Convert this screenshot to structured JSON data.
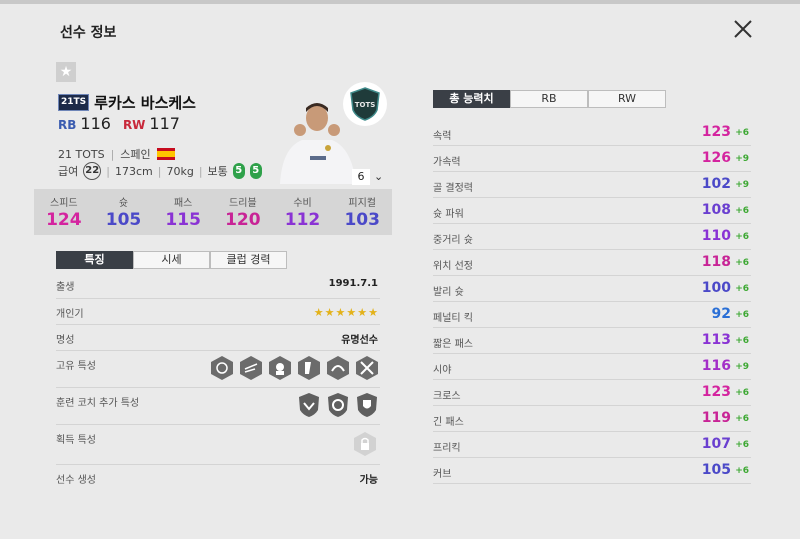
{
  "header": {
    "title": "선수 정보"
  },
  "player": {
    "season": "21TS",
    "name": "루카스 바스케스",
    "positions": [
      {
        "pos": "RB",
        "ovr": "116"
      },
      {
        "pos": "RW",
        "ovr": "117"
      }
    ],
    "season_label": "21 TOTS",
    "nation": "스페인",
    "pay_label": "급여",
    "pay": "22",
    "height": "173cm",
    "weight": "70kg",
    "body": "보통",
    "foot_left": "5",
    "foot_right": "5",
    "badge_text": "TOTS",
    "level": "6"
  },
  "stats": [
    {
      "label": "스피드",
      "value": "124",
      "color": "#d4249f"
    },
    {
      "label": "슛",
      "value": "105",
      "color": "#4b49c8"
    },
    {
      "label": "패스",
      "value": "115",
      "color": "#8a33d4"
    },
    {
      "label": "드리블",
      "value": "120",
      "color": "#c82496"
    },
    {
      "label": "수비",
      "value": "112",
      "color": "#8a33d4"
    },
    {
      "label": "피지컬",
      "value": "103",
      "color": "#4b49c8"
    }
  ],
  "left_tabs": [
    "특징",
    "시세",
    "클럽 경력"
  ],
  "details": {
    "birth_label": "출생",
    "birth": "1991.7.1",
    "popularity_label": "개인기",
    "popularity_stars": 6,
    "fame_label": "명성",
    "fame": "유명선수",
    "traits_label": "고유 특성",
    "trait_icons": [
      "power-header-icon",
      "speed-dribbler-icon",
      "playmaker-icon",
      "power-shot-icon",
      "outside-foot-icon",
      "chip-shot-icon"
    ],
    "coach_label": "훈련 코치 추가 특성",
    "coach_icons": [
      "aerial-icon",
      "stamina-icon",
      "defender-icon"
    ],
    "acquired_label": "획득 특성",
    "generate_label": "선수 생성",
    "generate": "가능"
  },
  "right_tabs": [
    "총 능력치",
    "RB",
    "RW"
  ],
  "abilities": [
    {
      "name": "속력",
      "value": "123",
      "bonus": "+6",
      "color": "#d4249f"
    },
    {
      "name": "가속력",
      "value": "126",
      "bonus": "+9",
      "color": "#d4249f"
    },
    {
      "name": "골 결정력",
      "value": "102",
      "bonus": "+9",
      "color": "#4b49c8"
    },
    {
      "name": "슛 파워",
      "value": "108",
      "bonus": "+6",
      "color": "#6a3fd0"
    },
    {
      "name": "중거리 슛",
      "value": "110",
      "bonus": "+6",
      "color": "#8a33d4"
    },
    {
      "name": "위치 선정",
      "value": "118",
      "bonus": "+6",
      "color": "#c82496"
    },
    {
      "name": "발리 슛",
      "value": "100",
      "bonus": "+6",
      "color": "#4b49c8"
    },
    {
      "name": "페널티 킥",
      "value": "92",
      "bonus": "+6",
      "color": "#2a6fd6"
    },
    {
      "name": "짧은 패스",
      "value": "113",
      "bonus": "+6",
      "color": "#8a33d4"
    },
    {
      "name": "시야",
      "value": "116",
      "bonus": "+9",
      "color": "#a42fc8"
    },
    {
      "name": "크로스",
      "value": "123",
      "bonus": "+6",
      "color": "#d4249f"
    },
    {
      "name": "긴 패스",
      "value": "119",
      "bonus": "+6",
      "color": "#c82496"
    },
    {
      "name": "프리킥",
      "value": "107",
      "bonus": "+6",
      "color": "#6a3fd0"
    },
    {
      "name": "커브",
      "value": "105",
      "bonus": "+6",
      "color": "#4b49c8"
    }
  ]
}
